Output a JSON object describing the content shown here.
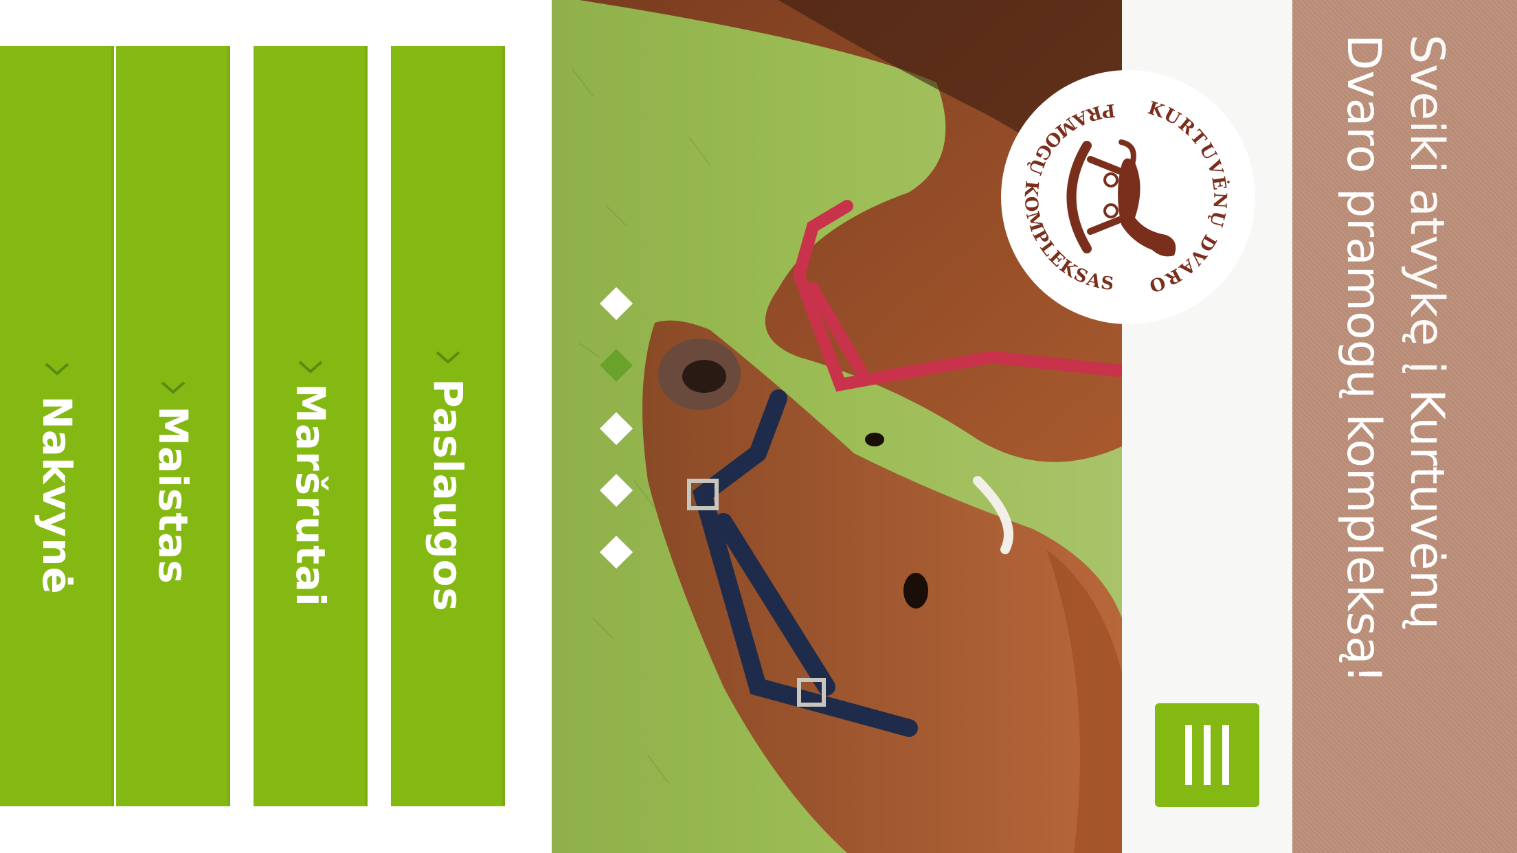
{
  "nav": {
    "items": [
      {
        "label": "Paslaugos"
      },
      {
        "label": "Maršrutai"
      },
      {
        "label": "Maistas"
      },
      {
        "label": "Nakvynė"
      }
    ]
  },
  "slider": {
    "dot_count": 5,
    "active_index": 1
  },
  "logo": {
    "top_text": "KURTUVĖNŲ DVARO",
    "bottom_text": "PRAMOGŲ KOMPLEKSAS"
  },
  "welcome": {
    "line1_thin": "Sveiki atvykę į ",
    "line1_strong": "Kurtuvėnų",
    "line2": "Dvaro pramogų kompleksą!"
  },
  "menu_button": {
    "icon": "hamburger-menu-icon"
  },
  "colors": {
    "accent_green": "#84b812",
    "active_dot": "#6aa32c",
    "welcome_brown": "#bd8f79",
    "logo_brown": "#7a2e1c"
  }
}
